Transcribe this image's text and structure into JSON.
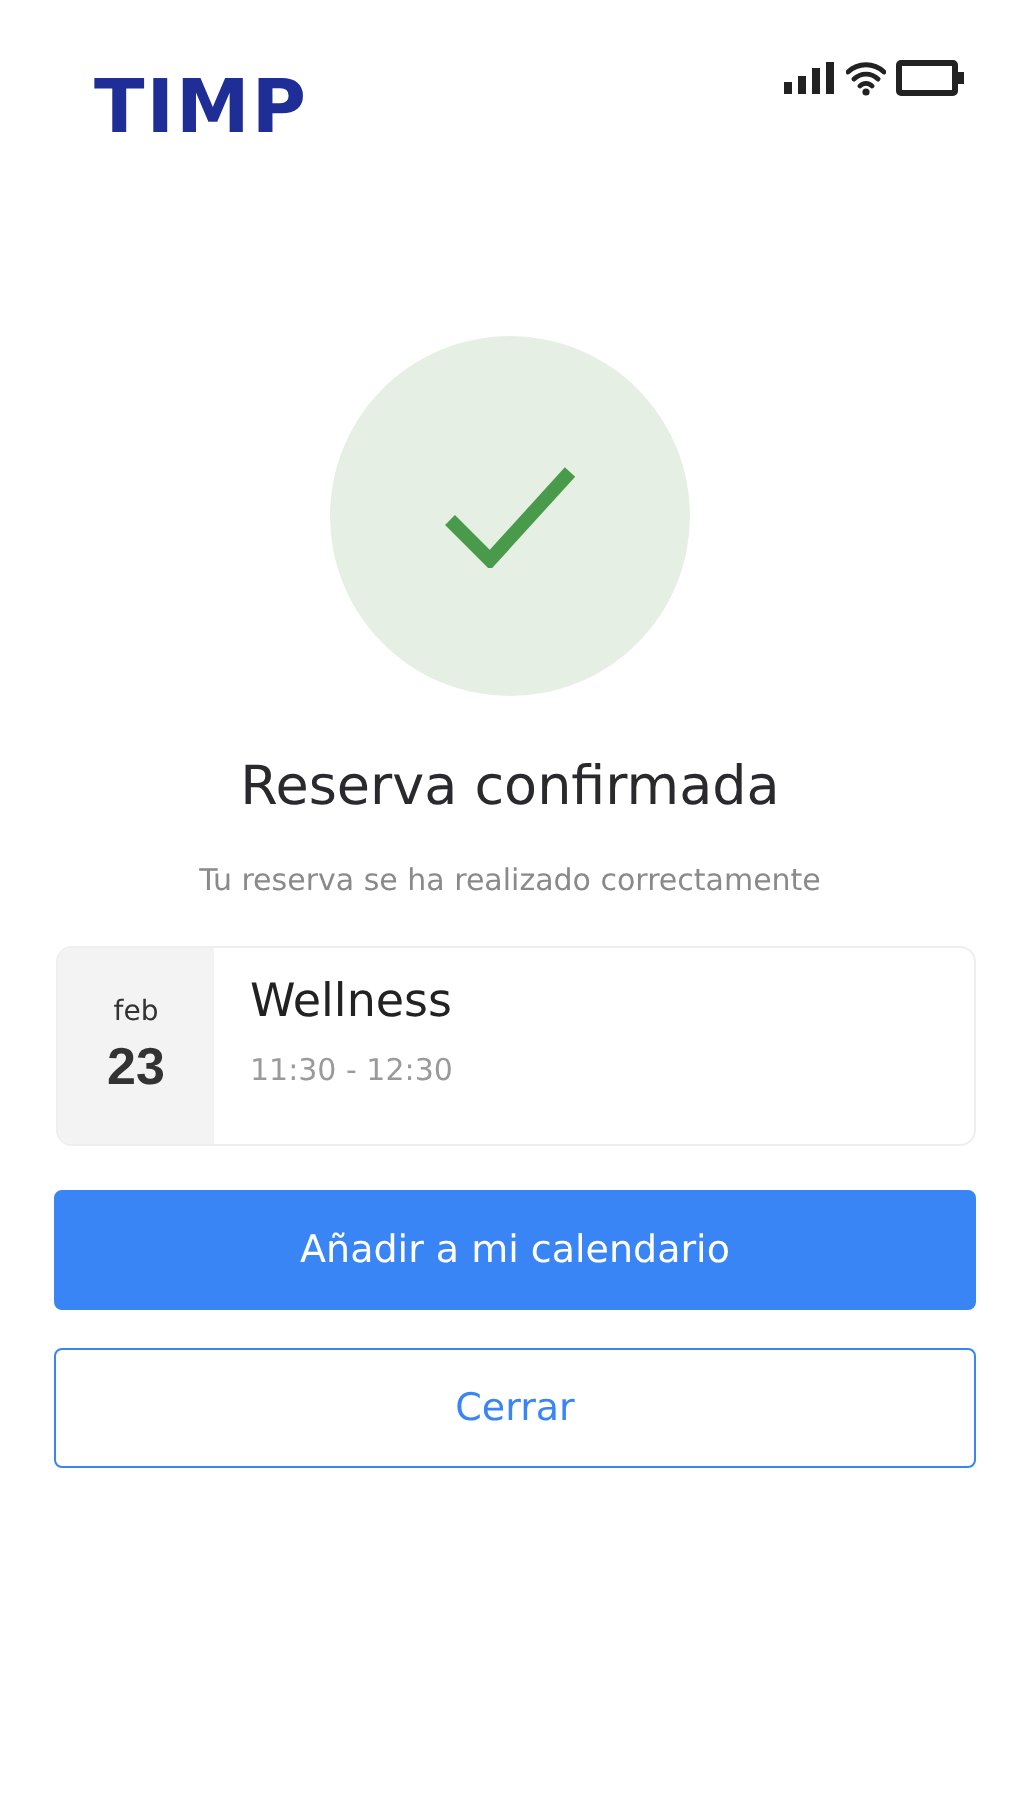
{
  "header": {
    "logo": "TIMP"
  },
  "confirmation": {
    "title": "Reserva confirmada",
    "subtitle": "Tu reserva se ha realizado correctamente"
  },
  "booking": {
    "month": "feb",
    "day": "23",
    "name": "Wellness",
    "time": "11:30 - 12:30"
  },
  "buttons": [
    {
      "label": "Añadir a mi calendario",
      "kind": "primary"
    },
    {
      "label": "Cerrar",
      "kind": "secondary"
    }
  ]
}
